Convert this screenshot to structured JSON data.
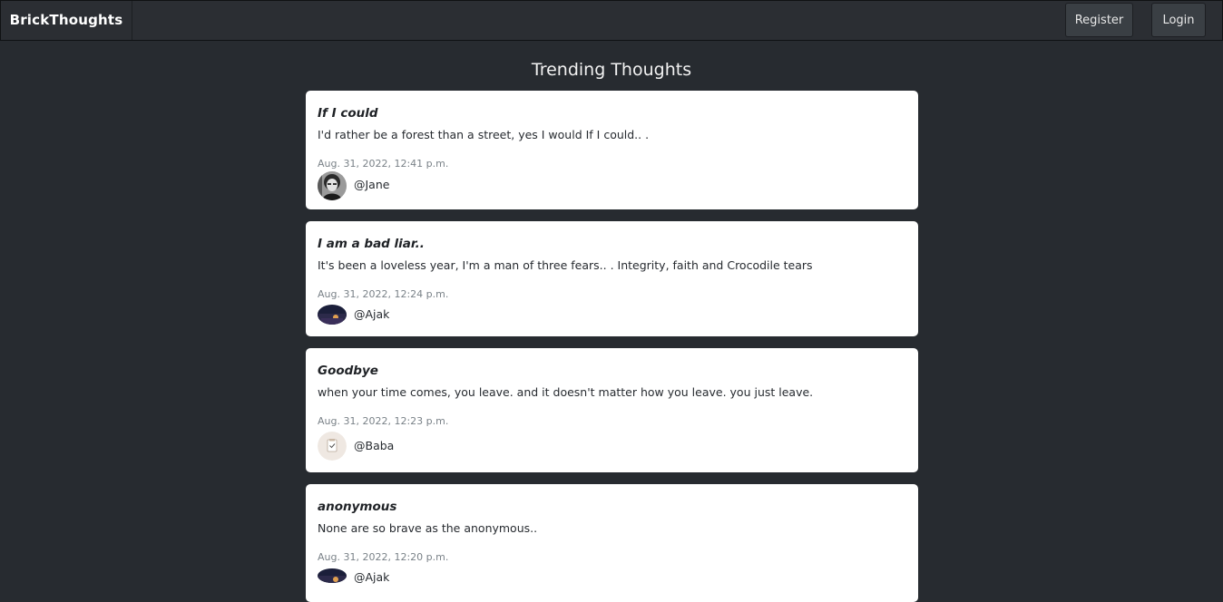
{
  "navbar": {
    "brand": "BrickThoughts",
    "register_label": "Register",
    "login_label": "Login"
  },
  "page": {
    "title": "Trending Thoughts"
  },
  "thoughts": [
    {
      "title": "If I could",
      "body": "I'd rather be a forest than a street, yes I would If I could.. .",
      "timestamp": "Aug. 31, 2022, 12:41 p.m.",
      "author": "@Jane",
      "avatar_icon": "bw-portrait"
    },
    {
      "title": "I am a bad liar..",
      "body": "It's been a loveless year, I'm a man of three fears.. . Integrity, faith and Crocodile tears",
      "timestamp": "Aug. 31, 2022, 12:24 p.m.",
      "author": "@Ajak",
      "avatar_icon": "night-sky"
    },
    {
      "title": "Goodbye",
      "body": "when your time comes, you leave. and it doesn't matter how you leave. you just leave.",
      "timestamp": "Aug. 31, 2022, 12:23 p.m.",
      "author": "@Baba",
      "avatar_icon": "clipboard-check"
    },
    {
      "title": "anonymous",
      "body": "None are so brave as the anonymous..",
      "timestamp": "Aug. 31, 2022, 12:20 p.m.",
      "author": "@Ajak",
      "avatar_icon": "night-sky"
    }
  ],
  "colors": {
    "background": "#272b30",
    "navbar": "#2b2e33",
    "button": "#3a3f44",
    "card": "#ffffff",
    "muted_text": "#7a8288"
  }
}
